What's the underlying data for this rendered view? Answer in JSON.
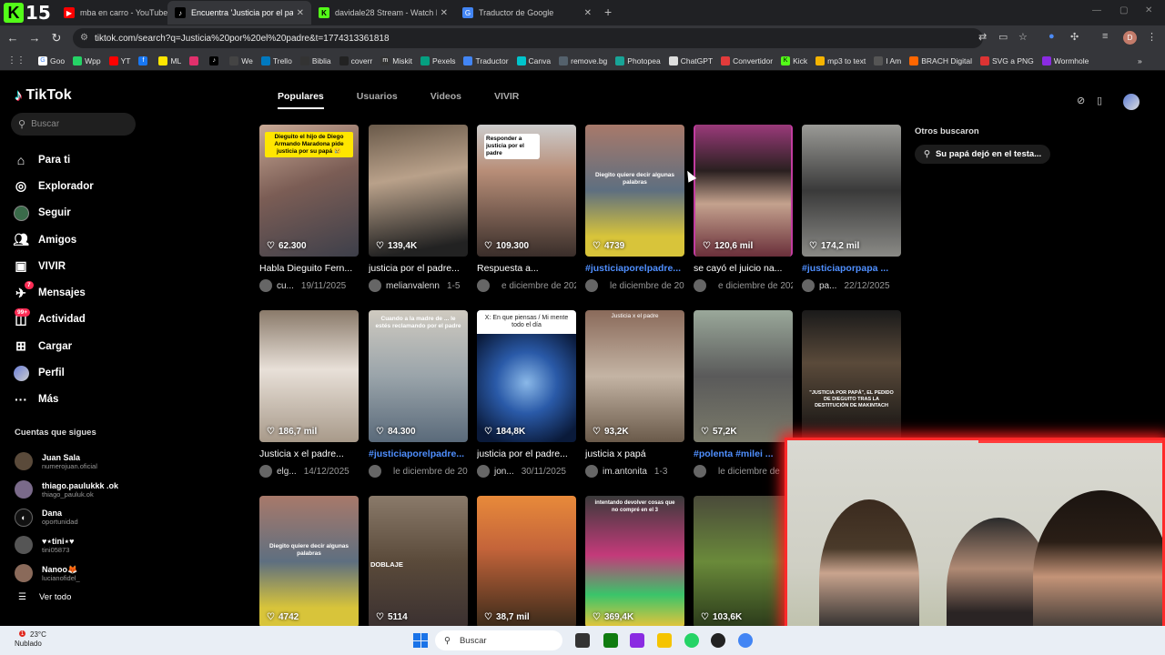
{
  "browser": {
    "tabs": [
      {
        "label": "mba en carro - YouTube",
        "icon": "youtube-icon",
        "active": false
      },
      {
        "label": "Encuentra 'Justicia por el padre",
        "icon": "tiktok-icon",
        "active": true
      },
      {
        "label": "davidale28 Stream - Watch Live",
        "icon": "kick-icon",
        "active": false
      },
      {
        "label": "Traductor de Google",
        "icon": "translate-icon",
        "active": false
      }
    ],
    "logo_number": "15",
    "url": "tiktok.com/search?q=Justicia%20por%20el%20padre&t=1774313361818",
    "profile_initial": "D",
    "bookmarks": [
      "Goo",
      "Wpp",
      "YT",
      "",
      "ML",
      "",
      "",
      "We",
      "Trello",
      "Biblia",
      "coverr",
      "Miskit",
      "Pexels",
      "Traductor",
      "Canva",
      "remove.bg",
      "Photopea",
      "ChatGPT",
      "Convertidor",
      "Kick",
      "mp3 to text",
      "I Am",
      "BRACH Digital",
      "SVG a PNG",
      "Wormhole"
    ]
  },
  "tiktok": {
    "brand": "TikTok",
    "search_placeholder": "Buscar",
    "nav": [
      {
        "label": "Para ti",
        "icon": "home-icon"
      },
      {
        "label": "Explorador",
        "icon": "compass-icon"
      },
      {
        "label": "Seguir",
        "icon": "following-avatar-icon"
      },
      {
        "label": "Amigos",
        "icon": "friends-icon"
      },
      {
        "label": "VIVIR",
        "icon": "live-icon"
      },
      {
        "label": "Mensajes",
        "icon": "messages-icon",
        "badge": "7"
      },
      {
        "label": "Actividad",
        "icon": "activity-icon",
        "badge": "99+"
      },
      {
        "label": "Cargar",
        "icon": "upload-icon"
      },
      {
        "label": "Perfil",
        "icon": "profile-icon"
      },
      {
        "label": "Más",
        "icon": "more-icon"
      }
    ],
    "following_heading": "Cuentas que sigues",
    "following": [
      {
        "name": "Juan Sala",
        "handle": "numerojuan.oficial"
      },
      {
        "name": "thiago.paulukkk .ok",
        "handle": "thiago_pauluk.ok"
      },
      {
        "name": "Dana",
        "handle": "oportunidad"
      },
      {
        "name": "♥⋆tini⋆♥",
        "handle": "tini05873"
      },
      {
        "name": "Nanoo🦊",
        "handle": "lucianofidel_"
      }
    ],
    "see_all": "Ver todo",
    "search_tabs": [
      "Populares",
      "Usuarios",
      "Videos",
      "VIVIR"
    ],
    "others_heading": "Otros buscaron",
    "others_chip": "Su papá dejó en el testa...",
    "videos": [
      {
        "views": "62.300",
        "title": "Habla Dieguito Fern...",
        "user": "cu...",
        "date": "19/11/2025",
        "tag": false,
        "caption": "Dieguito el hijo de Diego Armando Maradona pide justicia por su papá 😢"
      },
      {
        "views": "139,4K",
        "title": "justicia por el padre...",
        "user": "melianvalenn",
        "date": "1-5",
        "tag": false,
        "caption": ""
      },
      {
        "views": "109.300",
        "title": "Respuesta a...",
        "user": "",
        "date": "e diciembre de 2025",
        "tag": false,
        "caption": "Responder a justicia por el padre"
      },
      {
        "views": "4739",
        "title": "#justiciaporelpadre...",
        "user": "",
        "date": "le diciembre de 2025",
        "tag": true,
        "caption": "Diegito quiere decir algunas palabras"
      },
      {
        "views": "120,6 mil",
        "title": "se cayó el juicio na...",
        "user": "",
        "date": "e diciembre de 2025",
        "tag": false,
        "caption": ""
      },
      {
        "views": "174,2 mil",
        "title": "#justiciaporpapa ...",
        "user": "pa...",
        "date": "22/12/2025",
        "tag": true,
        "caption": ""
      },
      {
        "views": "186,7 mil",
        "title": "Justicia x el padre...",
        "user": "elg...",
        "date": "14/12/2025",
        "tag": false,
        "caption": ""
      },
      {
        "views": "84.300",
        "title": "#justiciaporelpadre...",
        "user": "",
        "date": "le diciembre de 2025",
        "tag": true,
        "caption": "Cuando a la madre de ... le estés reclamando por el padre"
      },
      {
        "views": "184,8K",
        "title": "justicia por el padre...",
        "user": "jon...",
        "date": "30/11/2025",
        "tag": false,
        "caption": "X: En que piensas / Mi mente todo el día"
      },
      {
        "views": "93,2K",
        "title": "justicia x papá",
        "user": "im.antonita",
        "date": "1-3",
        "tag": false,
        "caption": "Justicia x el padre"
      },
      {
        "views": "57,2K",
        "title": "#polenta #milei ...",
        "user": "",
        "date": "le diciembre de",
        "tag": true,
        "caption": ""
      },
      {
        "views": "",
        "title": "",
        "user": "",
        "date": "",
        "tag": false,
        "caption": "\"JUSTICIA POR PAPÁ\", EL PEDIDO DE DIEGUITO TRAS LA DESTITUCIÓN DE MAKINTACH"
      },
      {
        "views": "4742",
        "title": "",
        "user": "",
        "date": "",
        "tag": false,
        "caption": "Diegito quiere decir algunas palabras"
      },
      {
        "views": "5114",
        "title": "",
        "user": "",
        "date": "",
        "tag": false,
        "caption": "DOBLAJE"
      },
      {
        "views": "38,7 mil",
        "title": "",
        "user": "",
        "date": "",
        "tag": false,
        "caption": ""
      },
      {
        "views": "369,4K",
        "title": "",
        "user": "",
        "date": "",
        "tag": false,
        "caption": "intentando devolver cosas que no compré en el 3"
      },
      {
        "views": "103,6K",
        "title": "",
        "user": "",
        "date": "",
        "tag": false,
        "caption": ""
      }
    ]
  },
  "taskbar": {
    "temperature": "23°C",
    "weather": "Nublado",
    "alert": "1",
    "search": "Buscar"
  },
  "colors": {
    "accent": "#fe2c55",
    "link": "#4f8fff",
    "webcam_border": "#ff2a2a"
  }
}
